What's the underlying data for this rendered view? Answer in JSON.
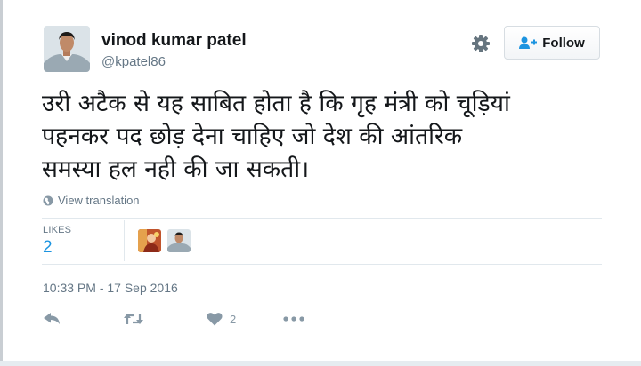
{
  "user": {
    "name": "vinod kumar patel",
    "handle": "@kpatel86"
  },
  "header": {
    "follow_label": "Follow"
  },
  "tweet": {
    "text": "उरी अटैक से यह साबित होता है कि गृह मंत्री को चूड़ियां\nपहनकर पद छोड़ देना चाहिए जो देश की आंतरिक\nसमस्या हल नही की जा सकती।",
    "translate_label": "View translation"
  },
  "stats": {
    "likes_label": "LIKES",
    "likes_count": "2"
  },
  "meta": {
    "timestamp": "10:33 PM - 17 Sep 2016"
  },
  "actions": {
    "like_count": "2"
  },
  "colors": {
    "link_blue": "#1c94e0",
    "muted_gray": "#657786",
    "icon_gray": "#8899a6",
    "divider": "#e1e8ed"
  },
  "icons": [
    "settings-gear-icon",
    "follow-person-icon",
    "globe-icon",
    "reply-icon",
    "retweet-icon",
    "heart-icon",
    "more-icon"
  ]
}
